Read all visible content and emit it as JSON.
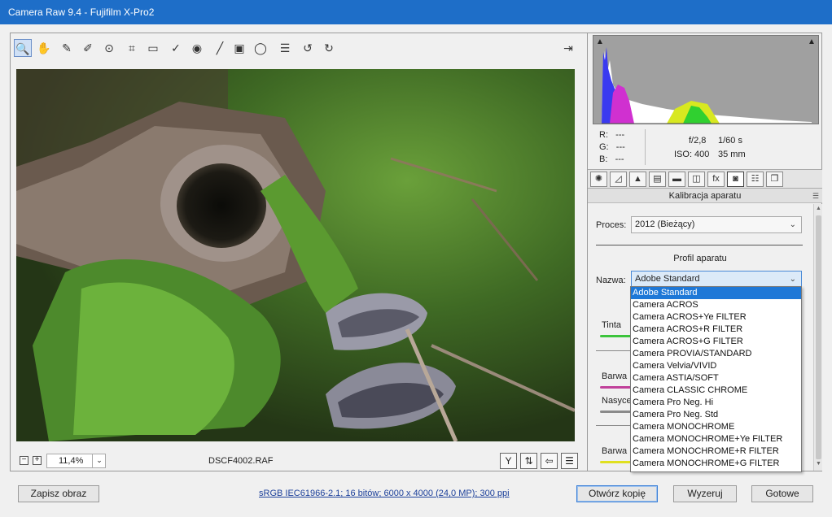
{
  "window": {
    "title": "Camera Raw 9.4  -  Fujifilm X-Pro2"
  },
  "toolbar": {
    "tools": [
      {
        "name": "zoom-icon",
        "glyph": "🔍"
      },
      {
        "name": "hand-icon",
        "glyph": "✋"
      },
      {
        "name": "white-balance-icon",
        "glyph": "✎"
      },
      {
        "name": "color-sampler-icon",
        "glyph": "✐"
      },
      {
        "name": "targeted-adjustment-icon",
        "glyph": "⊙"
      },
      {
        "name": "crop-icon",
        "glyph": "⌗"
      },
      {
        "name": "straighten-icon",
        "glyph": "▭"
      },
      {
        "name": "spot-removal-icon",
        "glyph": "✓"
      },
      {
        "name": "red-eye-icon",
        "glyph": "◉"
      },
      {
        "name": "adjustment-brush-icon",
        "glyph": "╱"
      },
      {
        "name": "graduated-filter-icon",
        "glyph": "▣"
      },
      {
        "name": "radial-filter-icon",
        "glyph": "◯"
      },
      {
        "name": "preferences-icon",
        "glyph": "☰"
      },
      {
        "name": "rotate-left-icon",
        "glyph": "↺"
      },
      {
        "name": "rotate-right-icon",
        "glyph": "↻"
      }
    ],
    "export_icon": "⇥"
  },
  "status": {
    "zoom_minus": "−",
    "zoom_plus": "+",
    "zoom_value": "11,4%",
    "zoom_arrow": "⌄",
    "filename": "DSCF4002.RAF",
    "icons": [
      "Y",
      "⇅",
      "⇦",
      "☰"
    ]
  },
  "readout": {
    "r_label": "R:",
    "r_value": "---",
    "g_label": "G:",
    "g_value": "---",
    "b_label": "B:",
    "b_value": "---",
    "aperture": "f/2,8",
    "shutter": "1/60 s",
    "iso": "ISO: 400",
    "focal": "35 mm"
  },
  "panel_tabs": [
    "✺",
    "◿",
    "▲",
    "▤",
    "▬",
    "◫",
    "fx",
    "◙",
    "☷",
    "❐"
  ],
  "panel": {
    "title": "Kalibracja aparatu",
    "menu_icon": "☰",
    "process_label": "Proces:",
    "process_value": "2012 (Bieżący)",
    "profile_heading": "Profil aparatu",
    "name_label": "Nazwa:",
    "name_value": "Adobe Standard",
    "sliders": [
      "Tinta",
      "Barwa",
      "Nasycenie",
      "Barwa"
    ]
  },
  "dropdown": {
    "options": [
      "Adobe Standard",
      "Camera ACROS",
      "Camera ACROS+Ye FILTER",
      "Camera ACROS+R FILTER",
      "Camera ACROS+G FILTER",
      "Camera PROVIA/STANDARD",
      "Camera Velvia/VIVID",
      "Camera ASTIA/SOFT",
      "Camera CLASSIC CHROME",
      "Camera Pro Neg. Hi",
      "Camera Pro Neg. Std",
      "Camera MONOCHROME",
      "Camera MONOCHROME+Ye FILTER",
      "Camera MONOCHROME+R FILTER",
      "Camera MONOCHROME+G FILTER"
    ],
    "selected": 0
  },
  "bottom": {
    "save_label": "Zapisz obraz",
    "info_link": "sRGB IEC61966-2.1; 16 bitów; 6000 x 4000 (24,0 MP); 300 ppi",
    "open_copy_label": "Otwórz kopię",
    "reset_label": "Wyzeruj",
    "done_label": "Gotowe"
  },
  "colors": {
    "title_bar": "#1e6ec8",
    "selection": "#1e78d7",
    "slider_green": "#3cc43c",
    "slider_magenta": "#c0409a",
    "slider_gray": "#8a8a8a",
    "slider_yellow": "#e0e020"
  }
}
